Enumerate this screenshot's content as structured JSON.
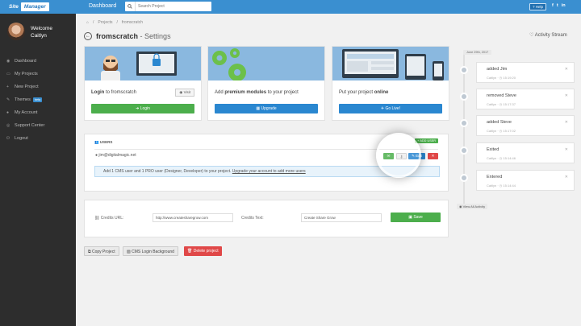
{
  "header": {
    "logo_left": "Site",
    "logo_right": "Manager",
    "dashboard_label": "Dashboard",
    "search_placeholder": "Search Project",
    "help_label": "Help",
    "social": [
      "f",
      "t",
      "in"
    ]
  },
  "user": {
    "welcome": "Welcome",
    "name": "Caitlyn"
  },
  "sidebar": {
    "items": [
      {
        "label": "Dashboard",
        "icon": "dashboard-icon"
      },
      {
        "label": "My Projects",
        "icon": "folder-icon"
      },
      {
        "label": "New Project",
        "icon": "plus-icon"
      },
      {
        "label": "Themes",
        "icon": "paint-icon",
        "badge": "beta"
      },
      {
        "label": "My Account",
        "icon": "user-icon"
      },
      {
        "label": "Support Center",
        "icon": "support-icon"
      },
      {
        "label": "Logout",
        "icon": "power-icon"
      }
    ]
  },
  "breadcrumb": [
    "Projects",
    "fromscratch"
  ],
  "page": {
    "title": "fromscratch",
    "title_suffix": "- Settings",
    "activity_title": "Activity Stream"
  },
  "cards": [
    {
      "label_pre": "Login",
      "label_post": "to fromscratch",
      "secondary": "Visit",
      "button": "Login",
      "color": "#4cae4c"
    },
    {
      "label_pre": "Add",
      "label_bold": "premium modules",
      "label_post": "to your project",
      "button": "Upgrade",
      "color": "#2a87d0"
    },
    {
      "label_pre": "Put your project",
      "label_bold": "online",
      "button": "Go Live!",
      "color": "#2a87d0"
    }
  ],
  "users": {
    "heading": "USERS",
    "add_button": "ADD USER",
    "email": "jim@digitalmagic.net",
    "edit_label": "Edit",
    "info_text": "Add 1 CMS user and 1 PRO user (Designer, Developer) to your project.",
    "info_link": "Upgrade your account to add more users"
  },
  "credits": {
    "url_label": "Credits URL:",
    "url_value": "http://www.createsharegrow.com",
    "text_label": "Credits Text:",
    "text_value": "Create Share Grow",
    "save_label": "Save"
  },
  "footer_buttons": {
    "copy": "Copy Project",
    "cms_bg": "CMS Login Background",
    "delete": "Delete project"
  },
  "activity": {
    "date": "June 29th, 2017",
    "view_all": "View All Activity",
    "items": [
      {
        "text": "added Jim",
        "user": "Caitlyn",
        "time": "15:19:20"
      },
      {
        "text": "removed Steve",
        "user": "Caitlyn",
        "time": "15:17:37"
      },
      {
        "text": "added Steve",
        "user": "Caitlyn",
        "time": "15:17:02"
      },
      {
        "text": "Exited",
        "user": "Caitlyn",
        "time": "15:14:46"
      },
      {
        "text": "Entered",
        "user": "Caitlyn",
        "time": "15:14:44"
      }
    ]
  },
  "colors": {
    "primary": "#3a8fd0",
    "success": "#4cae4c",
    "danger": "#e04848",
    "sidebar": "#2d2d2d"
  }
}
